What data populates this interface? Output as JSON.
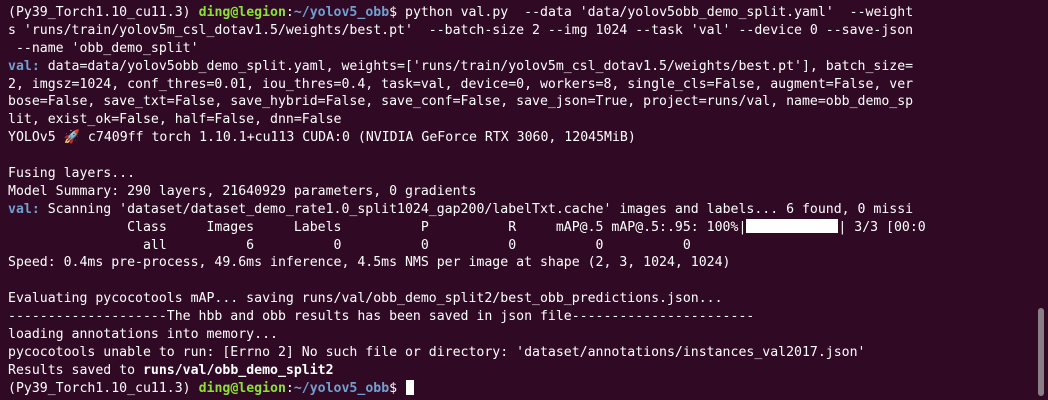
{
  "terminal": {
    "prompt1": {
      "env": "(Py39_Torch1.10_cu11.3) ",
      "user_host": "ding@legion",
      "colon": ":",
      "path": "~/yolov5_obb",
      "dollar": "$",
      "command": " python val.py  --data 'data/yolov5obb_demo_split.yaml'  --weight"
    },
    "cmd_cont": [
      "s 'runs/train/yolov5m_csl_dotav1.5/weights/best.pt'  --batch-size 2 --img 1024 --task 'val' --device 0 --save-json",
      " --name 'obb_demo_split'"
    ],
    "val_params": {
      "tag": "val:",
      "first": " data=data/yolov5obb_demo_split.yaml, weights=['runs/train/yolov5m_csl_dotav1.5/weights/best.pt'], batch_size=",
      "rest": [
        "2, imgsz=1024, conf_thres=0.01, iou_thres=0.4, task=val, device=0, workers=8, single_cls=False, augment=False, ver",
        "bose=False, save_txt=False, save_hybrid=False, save_conf=False, save_json=True, project=runs/val, name=obb_demo_sp",
        "lit, exist_ok=False, half=False, dnn=False"
      ]
    },
    "yolo_info": "YOLOv5 🚀 c7409ff torch 1.10.1+cu113 CUDA:0 (NVIDIA GeForce RTX 3060, 12045MiB)",
    "fusing": "Fusing layers... ",
    "model_summary": "Model Summary: 290 layers, 21640929 parameters, 0 gradients",
    "scan": {
      "tag": "val:",
      "text": " Scanning 'dataset/dataset_demo_rate1.0_split1024_gap200/labelTxt.cache' images and labels... 6 found, 0 missi"
    },
    "metrics_header": {
      "text": "               Class     Images     Labels          P          R     mAP@.5 mAP@.5:.95: 100%|",
      "progress": 1.0,
      "tail": "| 3/3 [00:0"
    },
    "metrics_row": "                 all          6          0          0          0          0          0",
    "speed": "Speed: 0.4ms pre-process, 49.6ms inference, 4.5ms NMS per image at shape (2, 3, 1024, 1024)",
    "evaluating": "Evaluating pycocotools mAP... saving runs/val/obb_demo_split2/best_obb_predictions.json...",
    "separator": "--------------------The hbb and obb results has been saved in json file-----------------------",
    "loading": "loading annotations into memory...",
    "pycoco_error": "pycocotools unable to run: [Errno 2] No such file or directory: 'dataset/annotations/instances_val2017.json'",
    "results": {
      "prefix": "Results saved to ",
      "path": "runs/val/obb_demo_split2"
    },
    "prompt2": {
      "env": "(Py39_Torch1.10_cu11.3) ",
      "user_host": "ding@legion",
      "colon": ":",
      "path": "~/yolov5_obb",
      "dollar": "$ "
    }
  },
  "colors": {
    "background": "#300a24",
    "user_host": "#8ae234",
    "path": "#729fcf",
    "val_tag": "#729fcf",
    "text": "#ffffff"
  }
}
